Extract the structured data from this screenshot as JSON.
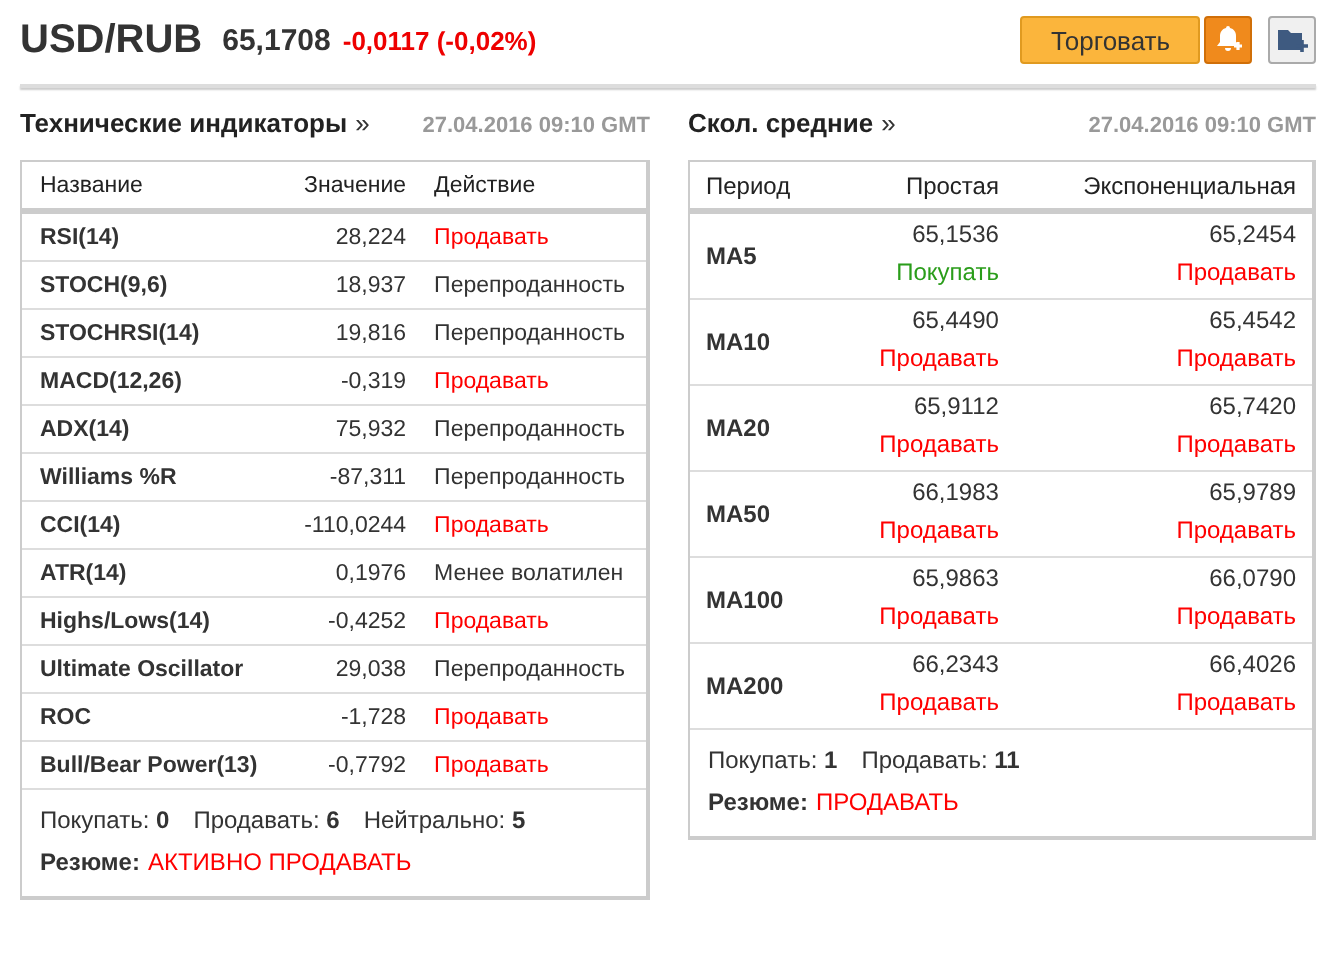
{
  "header": {
    "symbol": "USD/RUB",
    "price": "65,1708",
    "change": "-0,0117 (-0,02%)",
    "trade_button": "Торговать"
  },
  "technical": {
    "title": "Технические индикаторы",
    "arrow": "»",
    "time": "27.04.2016 09:10 GMT",
    "columns": [
      "Название",
      "Значение",
      "Действие"
    ],
    "rows": [
      {
        "name": "RSI(14)",
        "value": "28,224",
        "action": "Продавать",
        "kind": "sell"
      },
      {
        "name": "STOCH(9,6)",
        "value": "18,937",
        "action": "Перепроданность",
        "kind": "neutral"
      },
      {
        "name": "STOCHRSI(14)",
        "value": "19,816",
        "action": "Перепроданность",
        "kind": "neutral"
      },
      {
        "name": "MACD(12,26)",
        "value": "-0,319",
        "action": "Продавать",
        "kind": "sell"
      },
      {
        "name": "ADX(14)",
        "value": "75,932",
        "action": "Перепроданность",
        "kind": "neutral"
      },
      {
        "name": "Williams %R",
        "value": "-87,311",
        "action": "Перепроданность",
        "kind": "neutral"
      },
      {
        "name": "CCI(14)",
        "value": "-110,0244",
        "action": "Продавать",
        "kind": "sell"
      },
      {
        "name": "ATR(14)",
        "value": "0,1976",
        "action": "Менее волатилен",
        "kind": "neutral"
      },
      {
        "name": "Highs/Lows(14)",
        "value": "-0,4252",
        "action": "Продавать",
        "kind": "sell"
      },
      {
        "name": "Ultimate Oscillator",
        "value": "29,038",
        "action": "Перепроданность",
        "kind": "neutral"
      },
      {
        "name": "ROC",
        "value": "-1,728",
        "action": "Продавать",
        "kind": "sell"
      },
      {
        "name": "Bull/Bear Power(13)",
        "value": "-0,7792",
        "action": "Продавать",
        "kind": "sell"
      }
    ],
    "counts": [
      "Покупать: **0**",
      "Продавать: **6**",
      "Нейтрально: **5**"
    ],
    "summary": {
      "label": "Резюме:",
      "value": "АКТИВНО ПРОДАВАТЬ",
      "kind": "sell"
    }
  },
  "moving_averages": {
    "title": "Скол. средние",
    "arrow": "»",
    "time": "27.04.2016 09:10 GMT",
    "columns": [
      "Период",
      "Простая",
      "Экспоненциальная"
    ],
    "rows": [
      {
        "period": "MA5",
        "simple": {
          "value": "65,1536",
          "action": "Покупать",
          "kind": "buy"
        },
        "exponential": {
          "value": "65,2454",
          "action": "Продавать",
          "kind": "sell"
        }
      },
      {
        "period": "MA10",
        "simple": {
          "value": "65,4490",
          "action": "Продавать",
          "kind": "sell"
        },
        "exponential": {
          "value": "65,4542",
          "action": "Продавать",
          "kind": "sell"
        }
      },
      {
        "period": "MA20",
        "simple": {
          "value": "65,9112",
          "action": "Продавать",
          "kind": "sell"
        },
        "exponential": {
          "value": "65,7420",
          "action": "Продавать",
          "kind": "sell"
        }
      },
      {
        "period": "MA50",
        "simple": {
          "value": "66,1983",
          "action": "Продавать",
          "kind": "sell"
        },
        "exponential": {
          "value": "65,9789",
          "action": "Продавать",
          "kind": "sell"
        }
      },
      {
        "period": "MA100",
        "simple": {
          "value": "65,9863",
          "action": "Продавать",
          "kind": "sell"
        },
        "exponential": {
          "value": "66,0790",
          "action": "Продавать",
          "kind": "sell"
        }
      },
      {
        "period": "MA200",
        "simple": {
          "value": "66,2343",
          "action": "Продавать",
          "kind": "sell"
        },
        "exponential": {
          "value": "66,4026",
          "action": "Продавать",
          "kind": "sell"
        }
      }
    ],
    "counts": [
      "Покупать: **1**",
      "Продавать: **11**"
    ],
    "summary": {
      "label": "Резюме:",
      "value": "ПРОДАВАТЬ",
      "kind": "sell"
    }
  }
}
